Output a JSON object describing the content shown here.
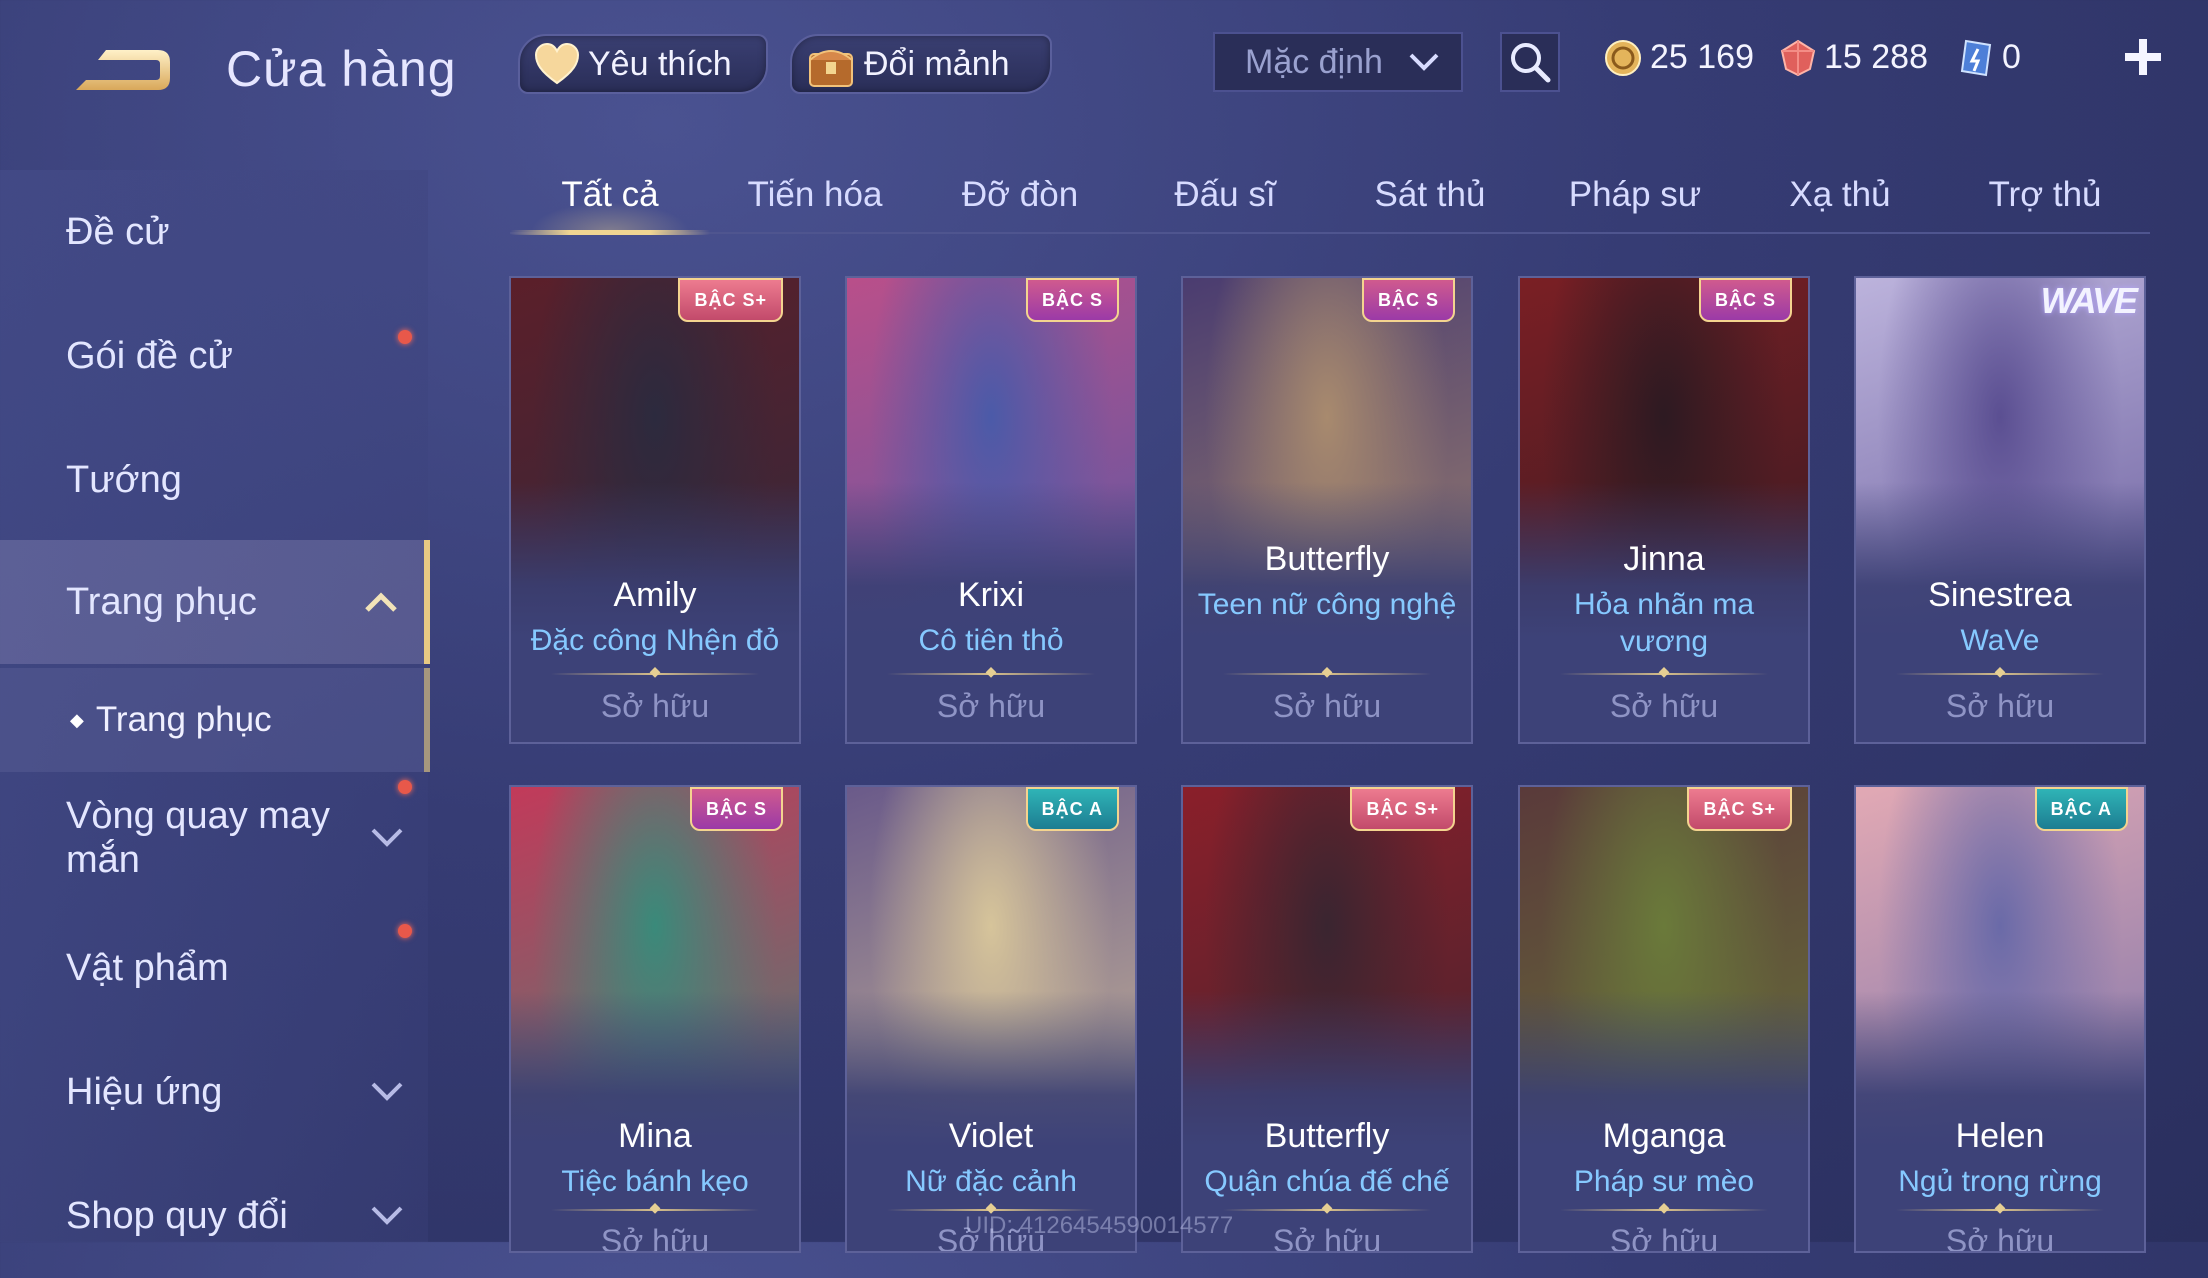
{
  "header": {
    "title": "Cửa hàng",
    "favorites_label": "Yêu thích",
    "shards_label": "Đổi mảnh",
    "sort_value": "Mặc định",
    "currencies": [
      {
        "name": "gold-coin-icon",
        "value": "25 169"
      },
      {
        "name": "ruby-icon",
        "value": "15 288"
      },
      {
        "name": "voucher-icon",
        "value": "0"
      }
    ]
  },
  "sidebar": {
    "items": [
      {
        "label": "Đề cử"
      },
      {
        "label": "Gói đề cử"
      },
      {
        "label": "Tướng"
      },
      {
        "label": "Trang phục"
      },
      {
        "label": "Trang phục"
      },
      {
        "label": "Vòng quay may mắn"
      },
      {
        "label": "Vật phẩm"
      },
      {
        "label": "Hiệu ứng"
      },
      {
        "label": "Shop quy đổi"
      }
    ]
  },
  "tabs": [
    "Tất cả",
    "Tiến hóa",
    "Đỡ đòn",
    "Đấu sĩ",
    "Sát thủ",
    "Pháp sư",
    "Xạ thủ",
    "Trợ thủ"
  ],
  "active_tab": "Tất cả",
  "cards": [
    {
      "hero": "Amily",
      "skin": "Đặc công Nhện đỏ",
      "status": "Sở hữu",
      "rank": "BẬC S+",
      "colors": [
        "#5b1f2a",
        "#2c2a3e"
      ]
    },
    {
      "hero": "Krixi",
      "skin": "Cô tiên thỏ",
      "status": "Sở hữu",
      "rank": "BẬC S",
      "colors": [
        "#b94f8a",
        "#4b5aa8"
      ]
    },
    {
      "hero": "Butterfly",
      "skin": "Teen nữ công nghệ",
      "status": "Sở hữu",
      "rank": "BẬC S",
      "colors": [
        "#4a3c70",
        "#a88a6e"
      ]
    },
    {
      "hero": "Jinna",
      "skin": "Hỏa nhãn ma vương",
      "status": "Sở hữu",
      "rank": "BẬC S",
      "colors": [
        "#7a1f24",
        "#2d1a22"
      ]
    },
    {
      "hero": "Sinestrea",
      "skin": "WaVe",
      "status": "Sở hữu",
      "rank": "WAVE",
      "colors": [
        "#bcb3dc",
        "#5b4f92"
      ]
    },
    {
      "hero": "Mina",
      "skin": "Tiệc bánh kẹo",
      "status": "Sở hữu",
      "rank": "BẬC S",
      "colors": [
        "#c23a5a",
        "#3a8a7a"
      ]
    },
    {
      "hero": "Violet",
      "skin": "Nữ đặc cảnh",
      "status": "Sở hữu",
      "rank": "BẬC A",
      "colors": [
        "#6a5a8a",
        "#d6c49a"
      ]
    },
    {
      "hero": "Butterfly",
      "skin": "Quận chúa đế chế",
      "status": "Sở hữu",
      "rank": "BẬC S+",
      "colors": [
        "#8a1f2a",
        "#3a2530"
      ]
    },
    {
      "hero": "Mganga",
      "skin": "Pháp sư mèo",
      "status": "Sở hữu",
      "rank": "BẬC S+",
      "colors": [
        "#5a3a3a",
        "#6a7a3a"
      ]
    },
    {
      "hero": "Helen",
      "skin": "Ngủ trong rừng",
      "status": "Sở hữu",
      "rank": "BẬC A",
      "colors": [
        "#e2a9b4",
        "#6a6aa8"
      ]
    }
  ],
  "watermark": "UID: 4126454590014577"
}
